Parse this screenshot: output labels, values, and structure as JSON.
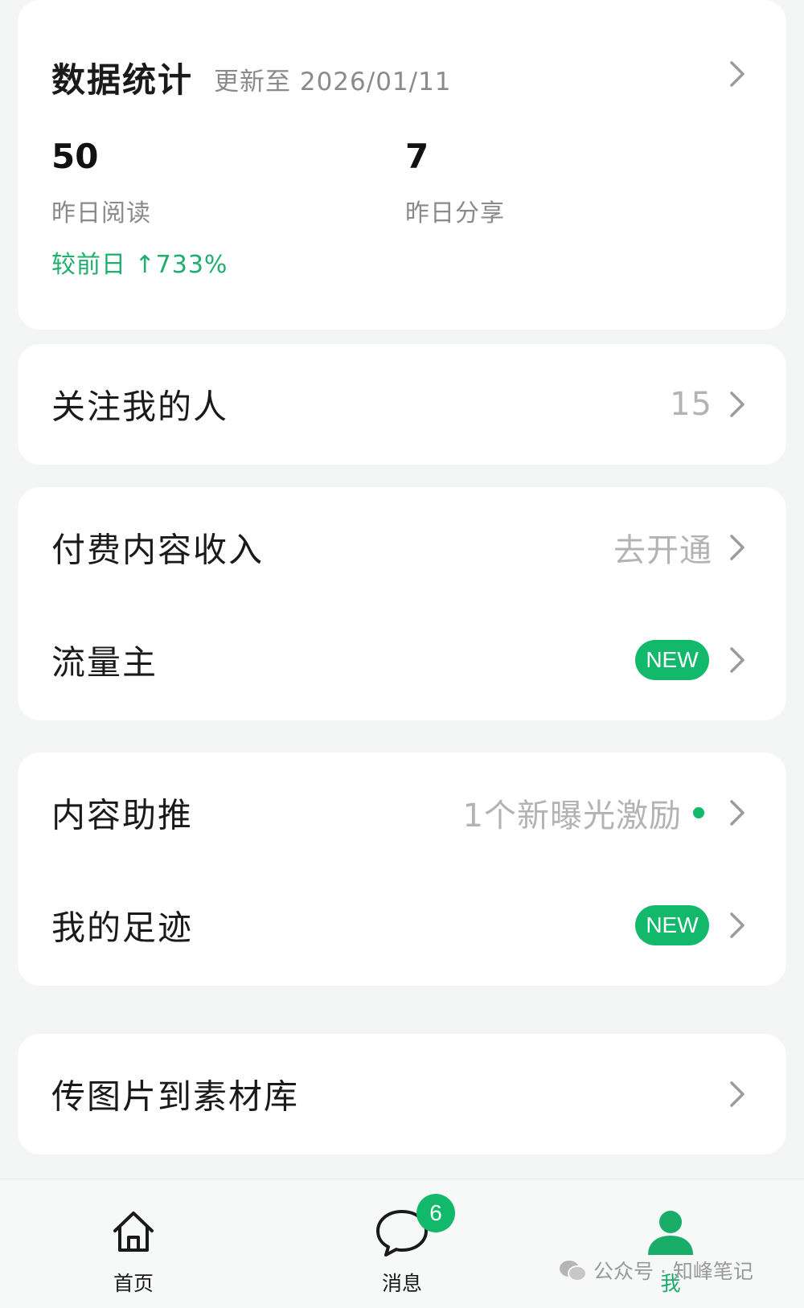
{
  "stats": {
    "title": "数据统计",
    "updated": "更新至 2026/01/11",
    "reads_value": "50",
    "reads_label": "昨日阅读",
    "shares_value": "7",
    "shares_label": "昨日分享",
    "trend": "较前日 ↑733%"
  },
  "followers": {
    "label": "关注我的人",
    "value": "15"
  },
  "paid": {
    "label": "付费内容收入",
    "value": "去开通"
  },
  "traffic": {
    "label": "流量主",
    "badge": "NEW"
  },
  "boost": {
    "label": "内容助推",
    "value": "1个新曝光激励"
  },
  "footprint": {
    "label": "我的足迹",
    "badge": "NEW"
  },
  "upload": {
    "label": "传图片到素材库"
  },
  "nav": {
    "home": "首页",
    "messages": "消息",
    "messages_badge": "6",
    "me": "我"
  },
  "watermark": "公众号 · 知峰笔记",
  "colors": {
    "accent": "#12b96a",
    "trend": "#1fae6d",
    "muted": "#8a8a8a"
  }
}
